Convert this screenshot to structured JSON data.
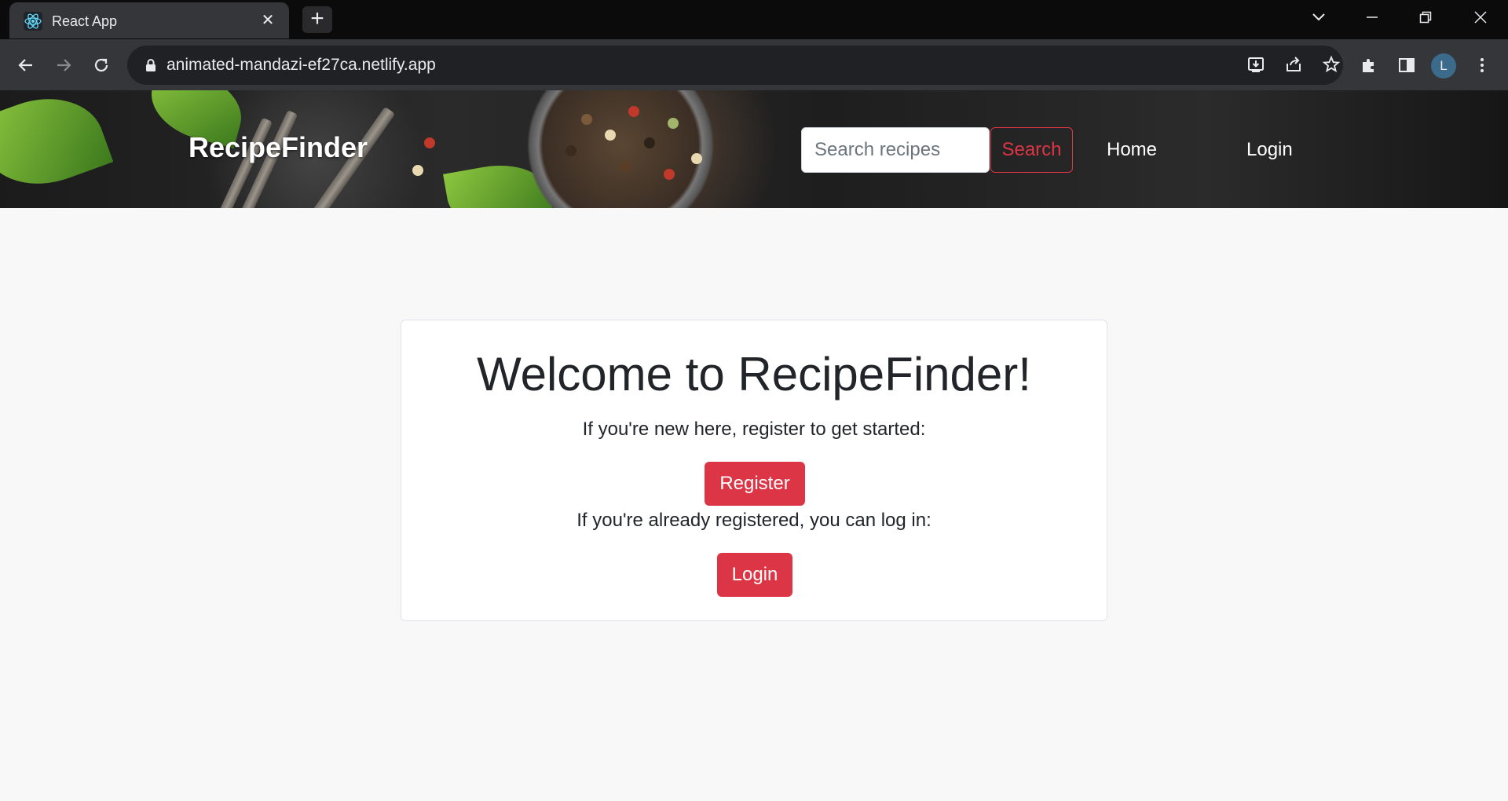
{
  "browser": {
    "tab_title": "React App",
    "tab_close": "✕",
    "new_tab": "+",
    "url": "animated-mandazi-ef27ca.netlify.app",
    "profile_initial": "L",
    "icons": [
      "react-icon",
      "back-icon",
      "forward-icon",
      "reload-icon",
      "lock-icon",
      "install-icon",
      "share-icon",
      "star-icon",
      "extensions-icon",
      "sidepanel-icon",
      "menu-icon"
    ]
  },
  "header": {
    "brand": "RecipeFinder",
    "search_placeholder": "Search recipes",
    "search_button": "Search",
    "nav": {
      "home": "Home",
      "login": "Login"
    }
  },
  "card": {
    "title": "Welcome to RecipeFinder!",
    "register_prompt": "If you're new here, register to get started:",
    "register_button": "Register",
    "login_prompt": "If you're already registered, you can log in:",
    "login_button": "Login"
  },
  "colors": {
    "accent": "#dc3545",
    "page_background": "#f8f8f8",
    "chrome_dark": "#35363a"
  }
}
